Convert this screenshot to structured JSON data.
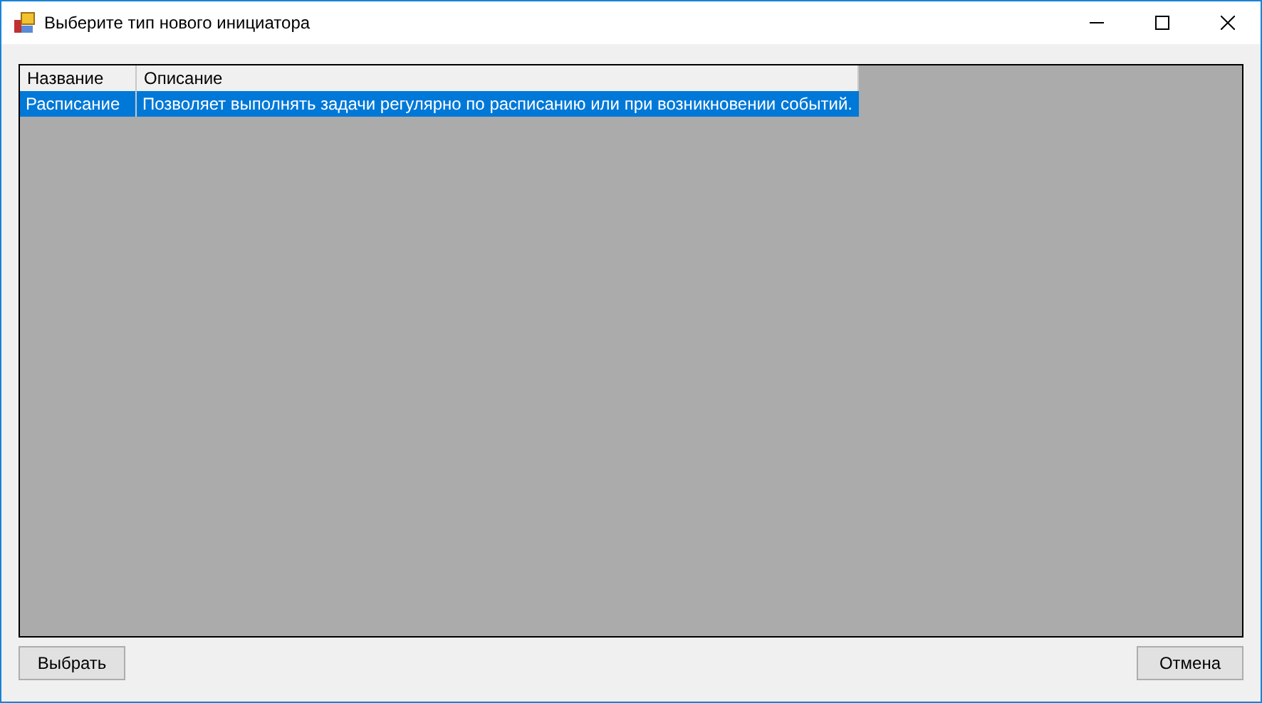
{
  "window": {
    "title": "Выберите тип нового инициатора"
  },
  "table": {
    "columns": [
      "Название",
      "Описание"
    ],
    "rows": [
      {
        "cells": [
          "Расписание",
          "Позволяет выполнять задачи регулярно по расписанию или при возникновении событий."
        ],
        "selected": true
      }
    ]
  },
  "buttons": [
    {
      "label": "Выбрать",
      "kind": "left"
    },
    {
      "label": "Отмена",
      "kind": "right"
    }
  ]
}
